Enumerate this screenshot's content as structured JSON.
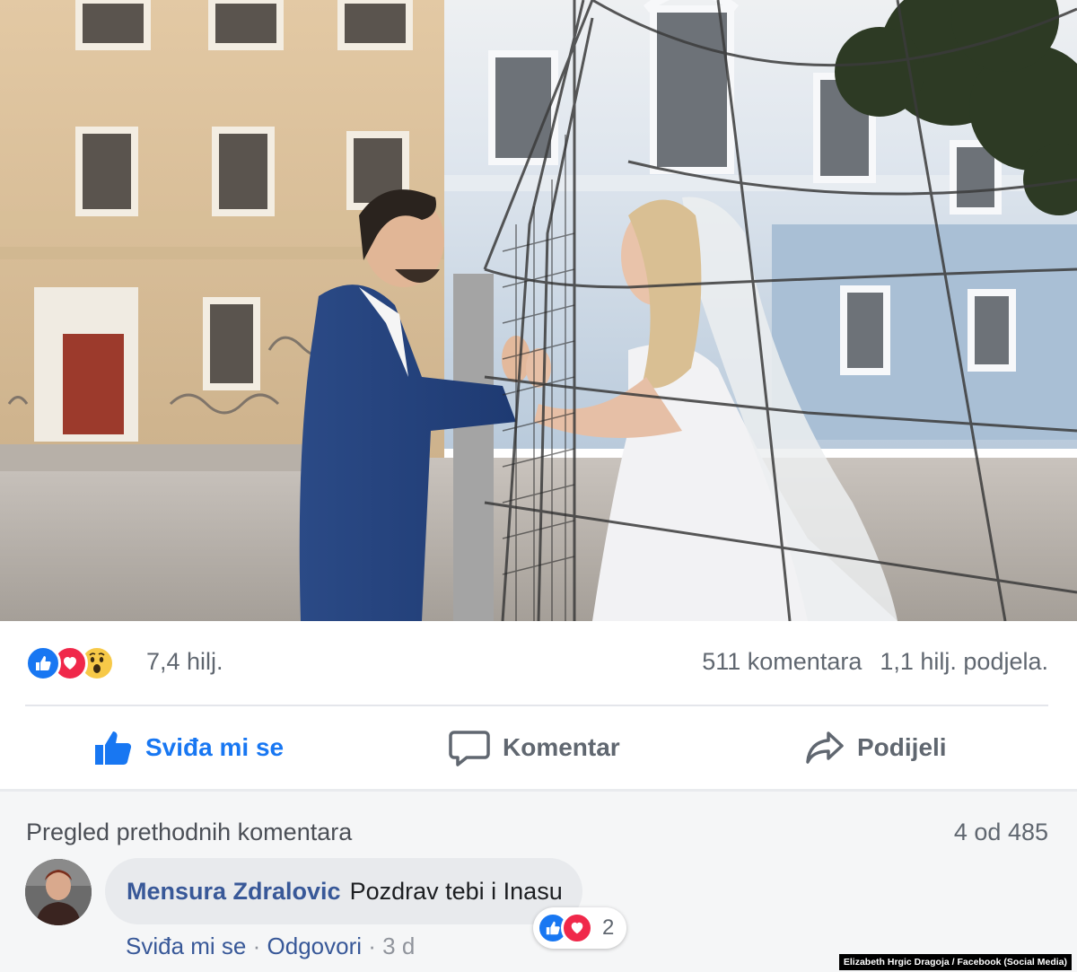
{
  "post": {
    "reactions_count": "7,4 hilj.",
    "comments_count": "511 komentara",
    "shares_count": "1,1 hilj. podjela.",
    "reaction_icons": [
      "like-icon",
      "love-icon",
      "wow-icon"
    ]
  },
  "actions": {
    "like_label": "Sviđa mi se",
    "comment_label": "Komentar",
    "share_label": "Podijeli"
  },
  "comments": {
    "view_previous_label": "Pregled prethodnih komentara",
    "count_label": "4 od 485",
    "items": [
      {
        "author": "Mensura Zdralovic",
        "text": "Pozdrav tebi i Inasu",
        "reaction_count": "2",
        "like_label": "Sviđa mi se",
        "reply_label": "Odgovori",
        "time": "3 d"
      }
    ]
  },
  "credit": "Elizabeth Hrgic Dragoja / Facebook (Social Media)",
  "colors": {
    "accent": "#1877f2",
    "love": "#f0284a",
    "wow": "#f7c948",
    "author": "#385898",
    "secondary_text": "#606770"
  }
}
